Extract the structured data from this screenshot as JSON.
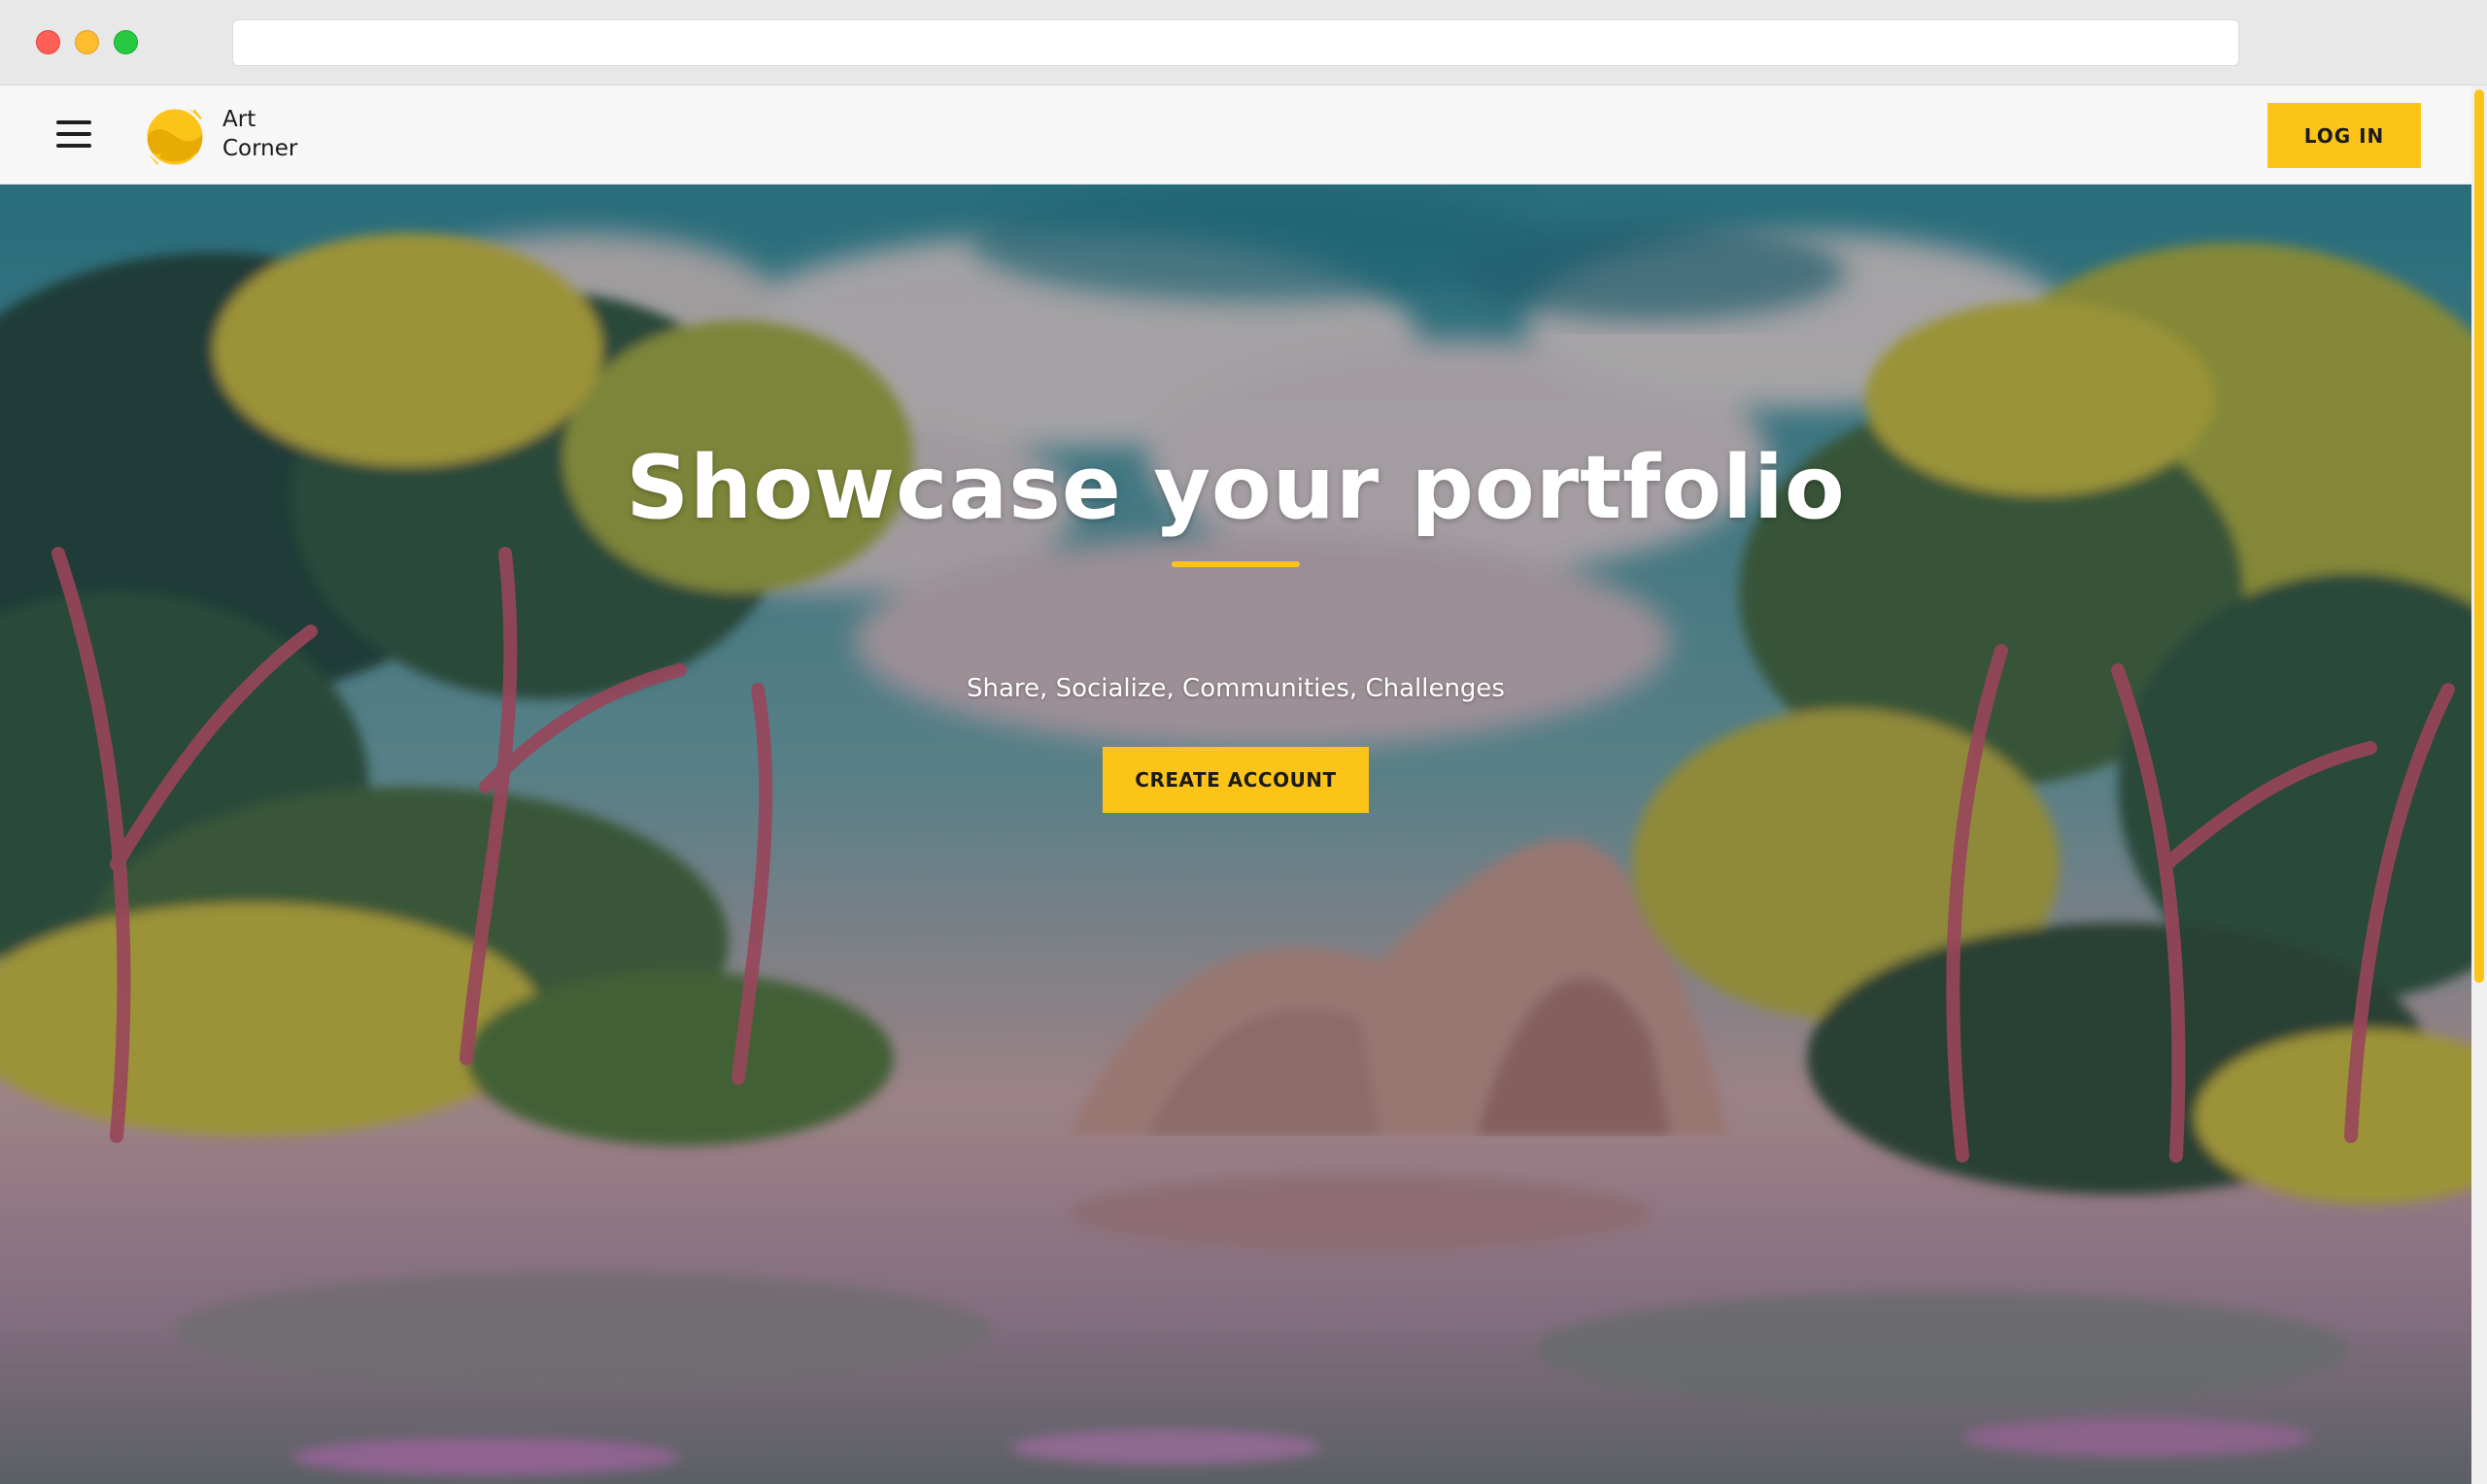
{
  "browser": {
    "url": ""
  },
  "header": {
    "brand_line1": "Art",
    "brand_line2": "Corner",
    "login_label": "LOG IN",
    "menu_icon": "hamburger-menu-icon",
    "logo_icon": "art-corner-logo"
  },
  "hero": {
    "title": "Showcase your portfolio",
    "subtitle": "Share, Socialize, Communities, Challenges",
    "cta_label": "CREATE ACCOUNT"
  },
  "colors": {
    "accent": "#fcc419",
    "header_bg": "#f7f7f7",
    "text_dark": "#1a1a1a"
  }
}
